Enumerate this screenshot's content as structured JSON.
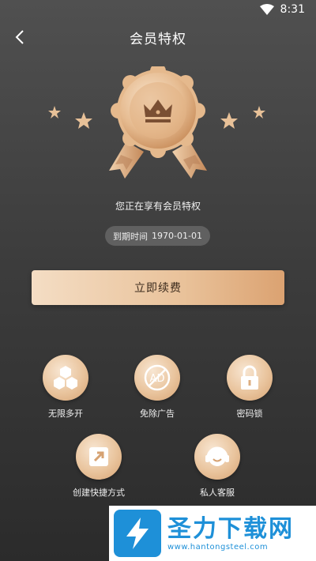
{
  "status_bar": {
    "time": "8:31",
    "wifi_icon": "wifi-icon"
  },
  "header": {
    "title": "会员特权",
    "back_icon": "chevron-left-icon"
  },
  "member": {
    "status_text": "您正在享有会员特权",
    "expire_label": "到期时间",
    "expire_date": "1970-01-01"
  },
  "renew_button": {
    "label": "立即续费"
  },
  "features": [
    {
      "label": "无限多开",
      "icon": "hexagons-icon"
    },
    {
      "label": "免除广告",
      "icon": "no-ad-icon"
    },
    {
      "label": "密码锁",
      "icon": "lock-icon"
    },
    {
      "label": "创建快捷方式",
      "icon": "shortcut-icon"
    },
    {
      "label": "私人客服",
      "icon": "headset-icon"
    }
  ],
  "watermark": {
    "title": "圣力下载网",
    "url": "www.hantongsteel.com"
  },
  "colors": {
    "accent_gold": "#e9c29a",
    "background": "#3d3d3d",
    "watermark_blue": "#1e90d8"
  }
}
